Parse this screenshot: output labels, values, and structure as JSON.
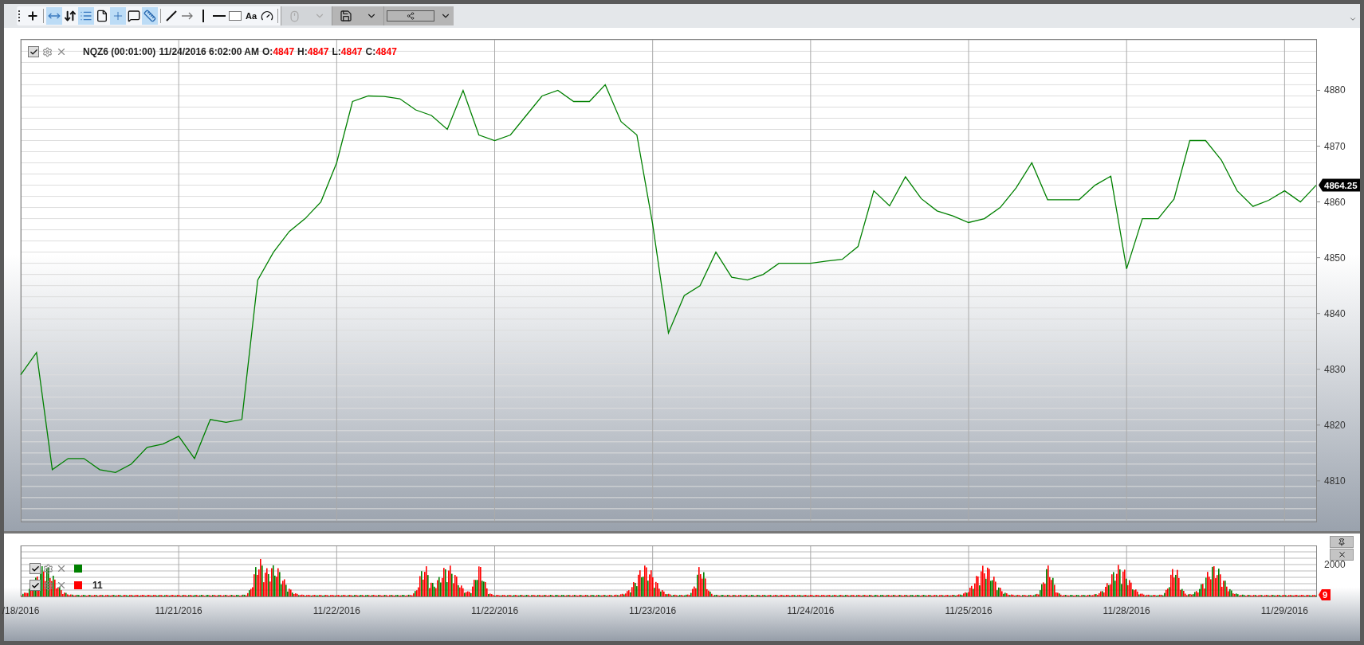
{
  "toolbar": {
    "groups": [
      [
        {
          "kind": "add",
          "selected": false
        }
      ],
      [
        {
          "kind": "pan",
          "selected": true
        },
        {
          "kind": "updown",
          "selected": false
        },
        {
          "kind": "list",
          "selected": true
        },
        {
          "kind": "page",
          "selected": false
        },
        {
          "kind": "crosshair",
          "selected": true
        },
        {
          "kind": "comment",
          "selected": false
        },
        {
          "kind": "ruler",
          "selected": true
        }
      ],
      [
        {
          "kind": "line",
          "selected": false
        },
        {
          "kind": "arrow",
          "selected": false
        },
        {
          "kind": "vline",
          "selected": false
        },
        {
          "kind": "hline",
          "selected": false
        },
        {
          "kind": "rect",
          "selected": false
        },
        {
          "kind": "text",
          "label": "Aa",
          "selected": false
        },
        {
          "kind": "gauge",
          "selected": false
        }
      ]
    ],
    "dropdowns": [
      {
        "kind": "mouse",
        "disabled": true
      },
      {
        "kind": "save",
        "disabled": false
      },
      {
        "kind": "share",
        "disabled": false
      }
    ]
  },
  "price_panel": {
    "legend": {
      "checked": true,
      "symbol": "NQZ6 (00:01:00)",
      "timestamp": "11/24/2016 6:02:00 AM",
      "ohlc": [
        {
          "label": "O:",
          "value": "4847"
        },
        {
          "label": "H:",
          "value": "4847"
        },
        {
          "label": "L:",
          "value": "4847"
        },
        {
          "label": "C:",
          "value": "4847"
        }
      ]
    },
    "last_price": "4864.25",
    "chart_data": {
      "type": "line",
      "grid": true,
      "ylim": [
        4802.7,
        4889.2
      ],
      "yticks": [
        4810,
        4820,
        4830,
        4840,
        4850,
        4860,
        4870,
        4880
      ],
      "categories": [
        "/18/2016",
        null,
        null,
        null,
        null,
        null,
        null,
        null,
        null,
        null,
        "11/21/2016",
        null,
        null,
        null,
        null,
        null,
        null,
        null,
        null,
        null,
        "11/22/2016",
        null,
        null,
        null,
        null,
        null,
        null,
        null,
        null,
        null,
        "11/22/2016",
        null,
        null,
        null,
        null,
        null,
        null,
        null,
        null,
        null,
        "11/23/2016",
        null,
        null,
        null,
        null,
        null,
        null,
        null,
        null,
        null,
        "11/24/2016",
        null,
        null,
        null,
        null,
        null,
        null,
        null,
        null,
        null,
        "11/25/2016",
        null,
        null,
        null,
        null,
        null,
        null,
        null,
        null,
        null,
        "11/28/2016",
        null,
        null,
        null,
        null,
        null,
        null,
        null,
        null,
        null,
        "11/29/2016",
        null,
        null
      ],
      "series": [
        {
          "color": "#008000",
          "values": [
            4829,
            4833,
            4812,
            4814,
            4814,
            4812,
            4811.5,
            4813,
            4816,
            4816.6,
            4818,
            4814,
            4821,
            4820.5,
            4821,
            4846,
            4851,
            4854.7,
            4857,
            4860,
            4867,
            4878,
            4879,
            4878.9,
            4878.5,
            4876.5,
            4875.5,
            4873,
            4880,
            4872,
            4871,
            4872,
            4875.5,
            4879,
            4880,
            4878,
            4878,
            4881,
            4874.4,
            4872,
            4856,
            4836.5,
            4843.2,
            4845,
            4851,
            4846.5,
            4846,
            4847,
            4849,
            4849,
            4849,
            4849.4,
            4849.7,
            4852,
            4862,
            4859.3,
            4864.5,
            4860.6,
            4858.4,
            4857.5,
            4856.3,
            4857,
            4859,
            4862.5,
            4867,
            4860.4,
            4860.4,
            4860.4,
            4863,
            4864.6,
            4848,
            4857,
            4857,
            4860.5,
            4871,
            4871,
            4867.5,
            4862,
            4859.2,
            4860.3,
            4862,
            4860,
            4863
          ]
        }
      ]
    }
  },
  "volume_panel": {
    "legend": [
      {
        "checked": true,
        "color": "#008000"
      },
      {
        "checked": true,
        "color": "#ff0000",
        "value": "11"
      }
    ],
    "ytick": "2000",
    "badge": "9"
  }
}
